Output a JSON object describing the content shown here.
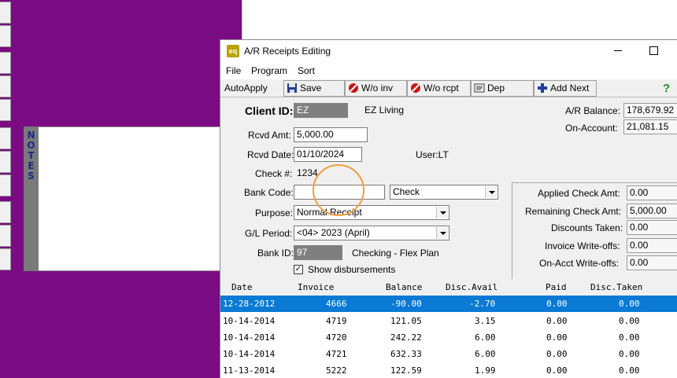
{
  "background": {
    "notes_letters": [
      "N",
      "O",
      "T",
      "E",
      "S"
    ],
    "purple_color": "#7b0b83"
  },
  "window": {
    "title": "A/R Receipts Editing",
    "app_icon_text": "eq"
  },
  "menu": [
    "File",
    "Program",
    "Sort"
  ],
  "toolbar": {
    "autoapply": "AutoApply",
    "save": "Save",
    "wo_inv": "W/o inv",
    "wo_rcpt": "W/o rcpt",
    "dep": "Dep",
    "add_next": "Add Next",
    "help": "?"
  },
  "form": {
    "client_id_label": "Client ID:",
    "client_id": "EZ",
    "client_name": "EZ Living",
    "rcvd_amt_label": "Rcvd Amt:",
    "rcvd_amt": "5,000.00",
    "rcvd_date_label": "Rcvd Date:",
    "rcvd_date": "01/10/2024",
    "user": "User:LT",
    "check_label": "Check #:",
    "check_no": "1234",
    "bank_code_label": "Bank Code:",
    "bank_code": "",
    "payment_type": "Check",
    "purpose_label": "Purpose:",
    "purpose": "Normal Receipt",
    "gl_period_label": "G/L Period:",
    "gl_period": "<04> 2023 (April)",
    "bank_id_label": "Bank ID:",
    "bank_id": "97",
    "bank_name": "Checking - Flex Plan",
    "show_disbursements": "Show disbursements",
    "show_disbursements_checked": true
  },
  "balances": {
    "ar_balance_label": "A/R Balance:",
    "ar_balance": "178,679.92",
    "on_account_label": "On-Account:",
    "on_account": "21,081.15"
  },
  "summary": {
    "applied_label": "Applied Check Amt:",
    "applied": "0.00",
    "remaining_label": "Remaining Check Amt:",
    "remaining": "5,000.00",
    "discounts_label": "Discounts Taken:",
    "discounts": "0.00",
    "invoice_wo_label": "Invoice Write-offs:",
    "invoice_wo": "0.00",
    "onacct_wo_label": "On-Acct Write-offs:",
    "onacct_wo": "0.00"
  },
  "grid": {
    "columns": [
      "Date",
      "Invoice",
      "Balance",
      "Disc.Avail",
      "Paid",
      "Disc.Taken"
    ],
    "rows": [
      {
        "date": "12-28-2012",
        "invoice": "4666",
        "balance": "-90.00",
        "disc_avail": "-2.70",
        "paid": "0.00",
        "disc_taken": "0.00"
      },
      {
        "date": "10-14-2014",
        "invoice": "4719",
        "balance": "121.05",
        "disc_avail": "3.15",
        "paid": "0.00",
        "disc_taken": "0.00"
      },
      {
        "date": "10-14-2014",
        "invoice": "4720",
        "balance": "242.22",
        "disc_avail": "6.00",
        "paid": "0.00",
        "disc_taken": "0.00"
      },
      {
        "date": "10-14-2014",
        "invoice": "4721",
        "balance": "632.33",
        "disc_avail": "6.00",
        "paid": "0.00",
        "disc_taken": "0.00"
      },
      {
        "date": "11-13-2014",
        "invoice": "5222",
        "balance": "122.59",
        "disc_avail": "1.99",
        "paid": "0.00",
        "disc_taken": "0.00"
      }
    ],
    "selected_row_color": "#0a7ad4"
  }
}
